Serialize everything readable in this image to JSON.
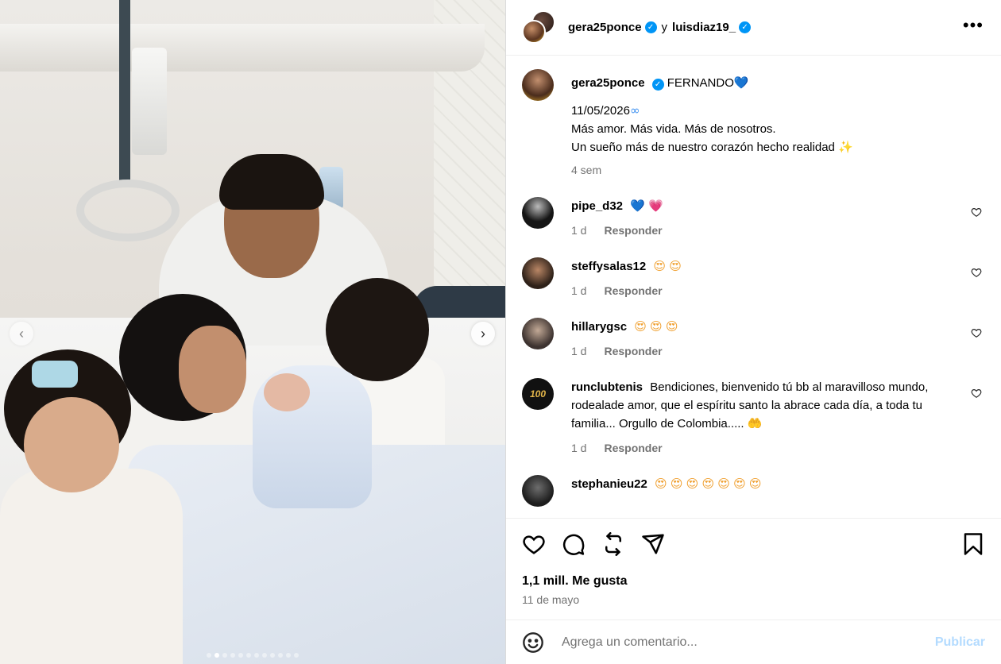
{
  "post": {
    "image_alt": "",
    "carousel": {
      "dot_count": 12,
      "active_index": 1
    }
  },
  "header": {
    "user1": "gera25ponce",
    "joiner": "y",
    "user2": "luisdiaz19_"
  },
  "caption": {
    "username": "gera25ponce",
    "title": "FERNANDO",
    "title_emoji": "💙",
    "date_line": "11/05/2026",
    "date_emoji": "∞",
    "line2": "Más amor. Más vida. Más de nosotros.",
    "line3": "Un sueño más de nuestro corazón hecho realidad",
    "line3_emoji": "✨",
    "time": "4 sem"
  },
  "comments": [
    {
      "username": "pipe_d32",
      "text": "",
      "emoji": [
        "💙",
        "💗"
      ],
      "time": "1 d",
      "reply": "Responder"
    },
    {
      "username": "steffysalas12",
      "text": "",
      "emoji": [
        "😍",
        "😍"
      ],
      "time": "1 d",
      "reply": "Responder"
    },
    {
      "username": "hillarygsc",
      "text": "",
      "emoji": [
        "😍",
        "😍",
        "😍"
      ],
      "time": "1 d",
      "reply": "Responder"
    },
    {
      "username": "runclubtenis",
      "avatar_label": "100",
      "text": "Bendiciones, bienvenido tú bb al maravilloso mundo, rodealade amor, que el espíritu santo la abrace cada día, a toda tu familia... Orgullo de Colombia.....",
      "emoji": [
        "🤲"
      ],
      "time": "1 d",
      "reply": "Responder"
    },
    {
      "username": "stephanieu22",
      "text": "",
      "emoji": [
        "😍",
        "😍",
        "😍",
        "😍",
        "😍",
        "😍",
        "😍"
      ],
      "time": "",
      "reply": ""
    }
  ],
  "engagement": {
    "likes": "1,1 mill. Me gusta",
    "date": "11 de mayo"
  },
  "composer": {
    "placeholder": "Agrega un comentario...",
    "publish": "Publicar"
  },
  "colors": {
    "verified": "#0095f6",
    "meta_gray": "#737373",
    "publish_disabled": "#b3dbff"
  }
}
